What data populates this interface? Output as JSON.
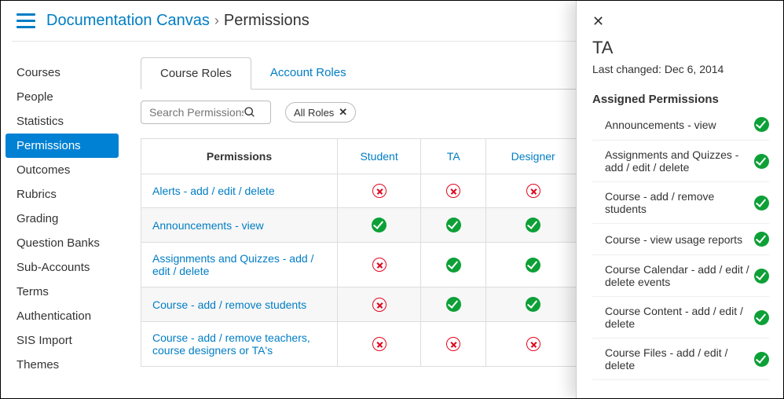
{
  "header": {
    "breadcrumb_root": "Documentation Canvas",
    "breadcrumb_current": "Permissions"
  },
  "sidebar": {
    "items": [
      "Courses",
      "People",
      "Statistics",
      "Permissions",
      "Outcomes",
      "Rubrics",
      "Grading",
      "Question Banks",
      "Sub-Accounts",
      "Terms",
      "Authentication",
      "SIS Import",
      "Themes"
    ],
    "active_index": 3
  },
  "main": {
    "tabs": [
      {
        "label": "Course Roles",
        "active": true
      },
      {
        "label": "Account Roles",
        "active": false
      }
    ],
    "search_placeholder": "Search Permissions",
    "role_filter": "All Roles",
    "table": {
      "headers": [
        "Permissions",
        "Student",
        "TA",
        "Designer"
      ],
      "rows": [
        {
          "name": "Alerts - add / edit / delete",
          "cells": [
            "no",
            "no",
            "no"
          ]
        },
        {
          "name": "Announcements - view",
          "cells": [
            "yes",
            "yes",
            "yes"
          ]
        },
        {
          "name": "Assignments and Quizzes - add / edit / delete",
          "cells": [
            "no",
            "yes",
            "yes"
          ]
        },
        {
          "name": "Course - add / remove students",
          "cells": [
            "no",
            "yes",
            "yes"
          ]
        },
        {
          "name": "Course - add / remove teachers, course designers or TA's",
          "cells": [
            "no",
            "no",
            "no"
          ]
        }
      ]
    }
  },
  "panel": {
    "title": "TA",
    "last_changed": "Last changed: Dec 6, 2014",
    "section_heading": "Assigned Permissions",
    "permissions": [
      "Announcements - view",
      "Assignments and Quizzes - add / edit / delete",
      "Course - add / remove students",
      "Course - view usage reports",
      "Course Calendar - add / edit / delete events",
      "Course Content - add / edit / delete",
      "Course Files - add / edit / delete"
    ]
  }
}
